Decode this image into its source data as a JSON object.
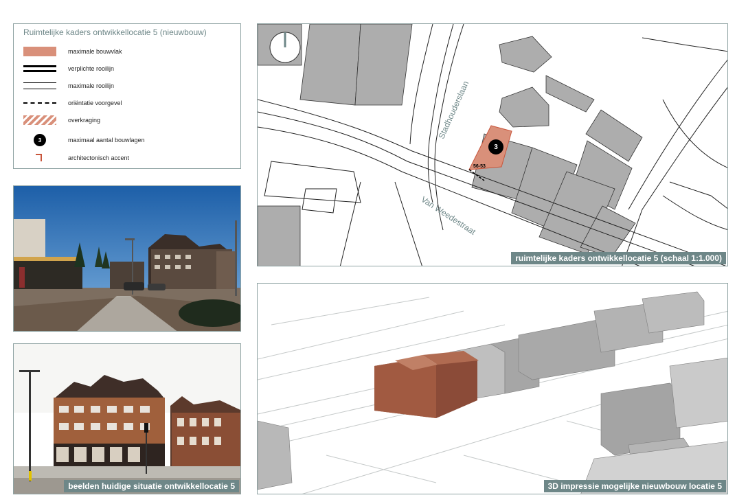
{
  "legend": {
    "title": "Ruimtelijke kaders ontwikkellocatie 5 (nieuwbouw)",
    "items": [
      {
        "label": "maximale bouwvlak",
        "icon": "salmon-fill-swatch"
      },
      {
        "label": "verplichte rooilijn",
        "icon": "bold-double-line"
      },
      {
        "label": "maximale rooilijn",
        "icon": "double-line"
      },
      {
        "label": "oriëntatie voorgevel",
        "icon": "dashed-line"
      },
      {
        "label": "overkraging",
        "icon": "hatched-swatch"
      },
      {
        "label": "maximaal aantal bouwlagen",
        "icon": "number-circle"
      },
      {
        "label": "architectonisch accent",
        "icon": "accent-corner"
      }
    ],
    "bouwlagen_symbol": "3"
  },
  "map": {
    "street1": "Stadhouderslaan",
    "street2": "Van Weedestraat",
    "floors": "3",
    "house_numbers": "56-53",
    "caption": "ruimtelijke kaders ontwikkellocatie 5 (schaal 1:1.000)"
  },
  "photos": {
    "caption": "beelden huidige situatie ontwikkellocatie 5"
  },
  "render": {
    "caption": "3D impressie mogelijke nieuwbouw locatie 5"
  },
  "colors": {
    "accent_teal": "#6e8788",
    "bouwvlak": "#d9907a",
    "building_grey": "#aaaaaa"
  }
}
